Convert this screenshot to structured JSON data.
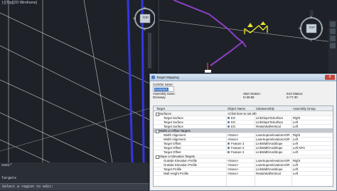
{
  "viewport_left": {
    "label": "[-][Top][2D Wireframe]"
  },
  "viewcube_left": {
    "top": "TOP",
    "n": "N",
    "e": "E",
    "s": "S",
    "w": "W"
  },
  "viewcube_right": {
    "top": "TOP",
    "n": "N",
    "e": "E",
    "s": "S",
    "w": "W"
  },
  "command_line": {
    "history": [
      "ose1*",
      "Targets"
    ],
    "prompt": "Select a region to edit:"
  },
  "dialog": {
    "title": "Target Mapping",
    "close_label": "X",
    "corridor_name_label": "Corridor name:",
    "corridor_name_value": "Corridor1",
    "assembly_name_label": "Assembly name:",
    "assembly_name_value": "Driveway",
    "start_station_label": "Start Station:",
    "start_station_value": "0+38.85",
    "end_station_label": "End Station:",
    "end_station_value": "2+77.30",
    "columns": [
      "Target",
      "Object Name",
      "Subassembly",
      "Assembly Group"
    ],
    "groups": {
      "surfaces": "Surfaces",
      "width_offset": "Width or Offset Targets",
      "slope_elevation": "Slope or Elevation Targets"
    },
    "rows": [
      {
        "target": "Target Surface",
        "object": "<Click here to set all>",
        "sub": "",
        "group": "",
        "icon": false
      },
      {
        "target": "Target Surface",
        "object": "EG",
        "sub": "LinkSlopeToSurface",
        "group": "Right",
        "icon": true
      },
      {
        "target": "Target Surface",
        "object": "EG",
        "sub": "LinkSlopeToSurface",
        "group": "Left",
        "icon": true
      },
      {
        "target": "Target Surface",
        "object": "EG",
        "sub": "RetainWallVertical",
        "group": "Left",
        "icon": true
      },
      {
        "target": "Width Alignment",
        "object": "<None>",
        "sub": "LaneSuperelevationAOR",
        "group": "Right",
        "icon": false
      },
      {
        "target": "Width Alignment",
        "object": "<None>",
        "sub": "LaneSuperelevationAOR",
        "group": "Left",
        "icon": false
      },
      {
        "target": "Target Offset",
        "object": "Feature 3",
        "sub": "LinkWidthAndSlope",
        "group": "Left",
        "icon": true
      },
      {
        "target": "Target Offset",
        "object": "Feature 3",
        "sub": "LinkWidthAndSlope",
        "group": "Left NP2",
        "icon": true
      },
      {
        "target": "Target Offset",
        "object": "Feature 3",
        "sub": "LinkWidthAndSlope",
        "group": "Left",
        "icon": true
      },
      {
        "target": "Outside Elevation Profile",
        "object": "<None>",
        "sub": "LaneSuperelevationAOR",
        "group": "Right",
        "icon": false
      },
      {
        "target": "Outside Elevation Profile",
        "object": "<None>",
        "sub": "LaneSuperelevationAOR",
        "group": "Left",
        "icon": false
      },
      {
        "target": "Target Profile",
        "object": "<None>",
        "sub": "LinkWidthAndSlope",
        "group": "Left",
        "icon": false
      },
      {
        "target": "Wall Height Profile",
        "object": "<None>",
        "sub": "RetainWallVertical",
        "group": "Left",
        "icon": false
      }
    ]
  },
  "colors": {
    "alignment": "#2f2fd8",
    "assembly": "#e7e22a",
    "dialog_title": "#c2d3e9"
  }
}
